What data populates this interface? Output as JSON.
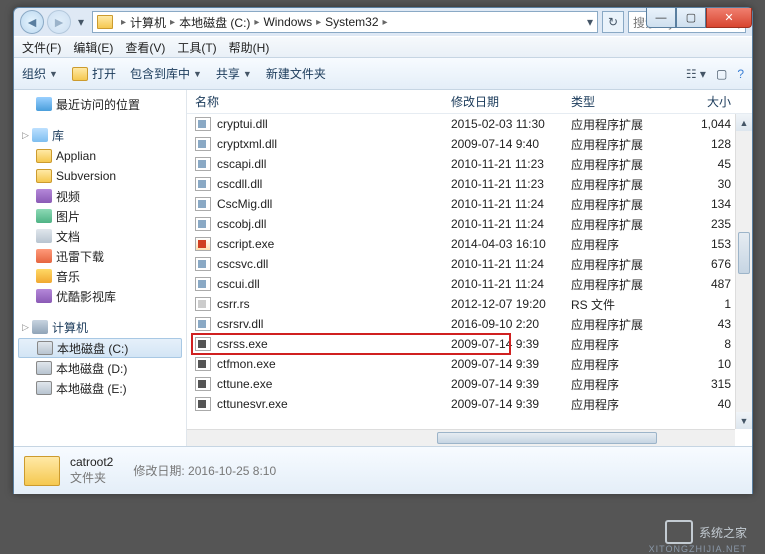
{
  "breadcrumb": {
    "seg1": "计算机",
    "seg2": "本地磁盘 (C:)",
    "seg3": "Windows",
    "seg4": "System32"
  },
  "search": {
    "placeholder": "搜索 System..."
  },
  "menu": {
    "file": "文件(F)",
    "edit": "编辑(E)",
    "view": "查看(V)",
    "tools": "工具(T)",
    "help": "帮助(H)"
  },
  "toolbar": {
    "organize": "组织",
    "open": "打开",
    "include": "包含到库中",
    "share": "共享",
    "newfolder": "新建文件夹"
  },
  "sidebar": {
    "recent": "最近访问的位置",
    "libraries": "库",
    "applian": "Applian",
    "subversion": "Subversion",
    "videos": "视频",
    "pictures": "图片",
    "documents": "文档",
    "xunlei": "迅雷下载",
    "music": "音乐",
    "youku": "优酷影视库",
    "computer": "计算机",
    "drive_c": "本地磁盘 (C:)",
    "drive_d": "本地磁盘 (D:)",
    "drive_e": "本地磁盘 (E:)"
  },
  "columns": {
    "name": "名称",
    "date": "修改日期",
    "type": "类型",
    "size": "大小"
  },
  "type_labels": {
    "dll": "应用程序扩展",
    "exe": "应用程序",
    "rs": "RS 文件"
  },
  "files": [
    {
      "name": "cryptui.dll",
      "date": "2015-02-03 11:30",
      "type": "应用程序扩展",
      "size": "1,044",
      "cls": "dll"
    },
    {
      "name": "cryptxml.dll",
      "date": "2009-07-14 9:40",
      "type": "应用程序扩展",
      "size": "128",
      "cls": "dll"
    },
    {
      "name": "cscapi.dll",
      "date": "2010-11-21 11:23",
      "type": "应用程序扩展",
      "size": "45",
      "cls": "dll"
    },
    {
      "name": "cscdll.dll",
      "date": "2010-11-21 11:23",
      "type": "应用程序扩展",
      "size": "30",
      "cls": "dll"
    },
    {
      "name": "CscMig.dll",
      "date": "2010-11-21 11:24",
      "type": "应用程序扩展",
      "size": "134",
      "cls": "dll"
    },
    {
      "name": "cscobj.dll",
      "date": "2010-11-21 11:24",
      "type": "应用程序扩展",
      "size": "235",
      "cls": "dll"
    },
    {
      "name": "cscript.exe",
      "date": "2014-04-03 16:10",
      "type": "应用程序",
      "size": "153",
      "cls": "script"
    },
    {
      "name": "cscsvc.dll",
      "date": "2010-11-21 11:24",
      "type": "应用程序扩展",
      "size": "676",
      "cls": "dll"
    },
    {
      "name": "cscui.dll",
      "date": "2010-11-21 11:24",
      "type": "应用程序扩展",
      "size": "487",
      "cls": "dll"
    },
    {
      "name": "csrr.rs",
      "date": "2012-12-07 19:20",
      "type": "RS 文件",
      "size": "1",
      "cls": "rs"
    },
    {
      "name": "csrsrv.dll",
      "date": "2016-09-10 2:20",
      "type": "应用程序扩展",
      "size": "43",
      "cls": "dll"
    },
    {
      "name": "csrss.exe",
      "date": "2009-07-14 9:39",
      "type": "应用程序",
      "size": "8",
      "cls": "exe",
      "highlight": true
    },
    {
      "name": "ctfmon.exe",
      "date": "2009-07-14 9:39",
      "type": "应用程序",
      "size": "10",
      "cls": "exe"
    },
    {
      "name": "cttune.exe",
      "date": "2009-07-14 9:39",
      "type": "应用程序",
      "size": "315",
      "cls": "exe"
    },
    {
      "name": "cttunesvr.exe",
      "date": "2009-07-14 9:39",
      "type": "应用程序",
      "size": "40",
      "cls": "exe"
    }
  ],
  "details": {
    "name": "catroot2",
    "type": "文件夹",
    "meta_label": "修改日期:",
    "meta_value": "2016-10-25 8:10"
  },
  "watermark": {
    "brand": "系统之家",
    "sub": "XITONGZHIJIA.NET"
  }
}
